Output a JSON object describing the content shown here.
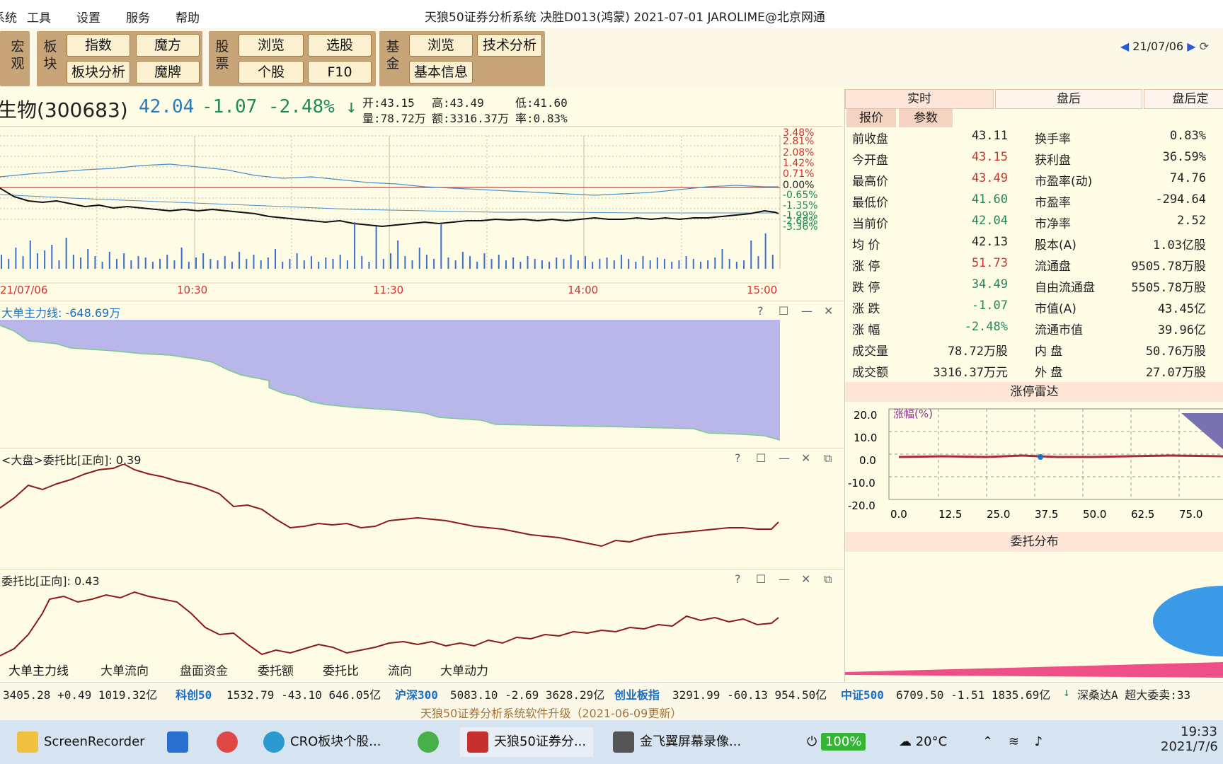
{
  "menu": {
    "items": [
      "系统",
      "工具",
      "设置",
      "服务",
      "帮助"
    ],
    "window_title": "天狼50证券分析系统  决胜D013(鸿蒙)  2021-07-01 JAROLIME@北京网通"
  },
  "toolbar": {
    "groups": [
      {
        "label": "宏观"
      },
      {
        "label": "板块",
        "buttons": [
          "指数",
          "魔方",
          "板块分析",
          "魔牌"
        ]
      },
      {
        "label": "股票",
        "buttons": [
          "浏览",
          "选股",
          "个股",
          "F10"
        ]
      },
      {
        "label": "基金",
        "buttons": [
          "浏览",
          "技术分析",
          "基本信息"
        ]
      }
    ],
    "date": "21/07/06"
  },
  "stock": {
    "name": "生物(300683)",
    "price": "42.04",
    "change": "-1.07 -2.48% ↓",
    "open": "开:43.15",
    "high": "高:43.49",
    "low": "低:41.60",
    "volume": "量:78.72万",
    "amount": "额:3316.37万",
    "turnover": "率:0.83%"
  },
  "main_chart": {
    "right_ticks_pos": [
      "3.48%",
      "2.81%",
      "2.08%",
      "1.42%",
      "0.71%"
    ],
    "zero_tick": "0.00%",
    "right_ticks_neg": [
      "-0.65%",
      "-1.35%",
      "-1.99%",
      "-2.68%",
      "-3.36%"
    ],
    "x_ticks": [
      "21/07/06",
      "10:30",
      "11:30",
      "14:00",
      "15:00"
    ]
  },
  "panels": {
    "p1_title": "大单主力线: -648.69万",
    "p2_title": "<大盘>委托比[正向]:  0.39",
    "p3_title": "委托比[正向]:  0.43",
    "ctrl_help": "?",
    "ctrl_max": "☐",
    "ctrl_min": "—",
    "ctrl_close": "✕",
    "ctrl_float": "⧉"
  },
  "bottom_tabs": [
    "大单主力线",
    "大单流向",
    "盘面资金",
    "委托额",
    "委托比",
    "流向",
    "大单动力"
  ],
  "index_bar": {
    "first": "3405.28  +0.49  1019.32亿",
    "items": [
      {
        "name": "科创50",
        "vals": "1532.79  -43.10  646.05亿"
      },
      {
        "name": "沪深300",
        "vals": "5083.10  -2.69  3628.29亿"
      },
      {
        "name": "创业板指",
        "vals": "3291.99  -60.13  954.50亿"
      },
      {
        "name": "中证500",
        "vals": "6709.50  -1.51  1835.69亿"
      }
    ],
    "tail": "深桑达A  超大委卖:33"
  },
  "status": {
    "text": "天狼50证券分析系统软件升级（2021-06-09更新）"
  },
  "right": {
    "tabs": [
      "实时",
      "盘后",
      "盘后定"
    ],
    "subtabs": [
      "报价",
      "参数"
    ],
    "left_rows": [
      [
        "前收盘",
        "43.11"
      ],
      [
        "今开盘",
        "43.15"
      ],
      [
        "最高价",
        "43.49"
      ],
      [
        "最低价",
        "41.60"
      ],
      [
        "当前价",
        "42.04"
      ],
      [
        "均  价",
        "42.13"
      ],
      [
        "涨  停",
        "51.73"
      ],
      [
        "跌  停",
        "34.49"
      ],
      [
        "涨  跌",
        "-1.07"
      ],
      [
        "涨  幅",
        "-2.48%"
      ],
      [
        "成交量",
        "78.72万股"
      ],
      [
        "成交额",
        "3316.37万元"
      ]
    ],
    "right_rows": [
      [
        "换手率",
        "0.83%"
      ],
      [
        "获利盘",
        "36.59%"
      ],
      [
        "市盈率(动)",
        "74.76"
      ],
      [
        "市盈率",
        "-294.64"
      ],
      [
        "市净率",
        "2.52"
      ],
      [
        "股本(A)",
        "1.03亿股"
      ],
      [
        "流通盘",
        "9505.78万股"
      ],
      [
        "自由流通盘",
        "5505.78万股"
      ],
      [
        "市值(A)",
        "43.45亿"
      ],
      [
        "流通市值",
        "39.96亿"
      ],
      [
        "内  盘",
        "50.76万股"
      ],
      [
        "外  盘",
        "27.07万股"
      ]
    ],
    "radar_title": "涨停雷达",
    "radar_ylabel": "涨幅(%)",
    "radar_yticks": [
      "20.0",
      "10.0",
      "0.0",
      "-10.0",
      "-20.0"
    ],
    "radar_xticks": [
      "0.0",
      "12.5",
      "25.0",
      "37.5",
      "50.0",
      "62.5",
      "75.0"
    ],
    "entrust_title": "委托分布"
  },
  "colors": {
    "up": "#cc3333",
    "down": "#1f8a5a",
    "accent": "#1a6fc4",
    "toolbar": "#c8a578",
    "bg": "#fffce6"
  },
  "taskbar": {
    "items": [
      "ScreenRecorder",
      "CRO板块个股...",
      "天狼50证券分...",
      "金飞翼屏幕录像..."
    ],
    "battery": "100%",
    "weather": "20°C",
    "time": "19:33",
    "date": "2021/7/6"
  }
}
